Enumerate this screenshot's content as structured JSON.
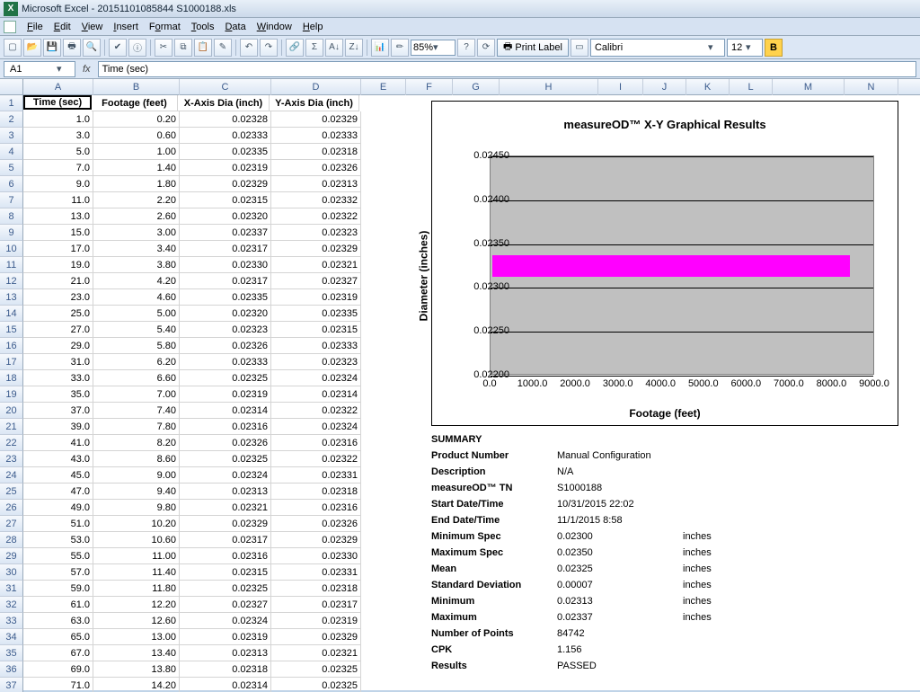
{
  "title": "Microsoft Excel - 20151101085844 S1000188.xls",
  "menus": [
    "File",
    "Edit",
    "View",
    "Insert",
    "Format",
    "Tools",
    "Data",
    "Window",
    "Help"
  ],
  "menu_underline_idx": [
    0,
    0,
    0,
    0,
    1,
    0,
    0,
    0,
    0
  ],
  "toolbar": {
    "zoom": "85%",
    "printlabel": "Print Label",
    "font": "Calibri",
    "size": "12",
    "bold": "B"
  },
  "namebox": "A1",
  "formula_fx": "fx",
  "formula": "Time (sec)",
  "col_letters": [
    "A",
    "B",
    "C",
    "D",
    "E",
    "F",
    "G",
    "H",
    "I",
    "J",
    "K",
    "L",
    "M",
    "N"
  ],
  "row_numbers": [
    "1",
    "2",
    "3",
    "4",
    "5",
    "6",
    "7",
    "8",
    "9",
    "10",
    "11",
    "12",
    "13",
    "14",
    "15",
    "16",
    "17",
    "18",
    "19",
    "20",
    "21",
    "22",
    "23",
    "24",
    "25",
    "26",
    "27",
    "28",
    "29",
    "30",
    "31",
    "32",
    "33",
    "34",
    "35",
    "36",
    "37"
  ],
  "headers": [
    "Time (sec)",
    "Footage (feet)",
    "X-Axis Dia (inch)",
    "Y-Axis Dia (inch)"
  ],
  "rows": [
    [
      "1.0",
      "0.20",
      "0.02328",
      "0.02329"
    ],
    [
      "3.0",
      "0.60",
      "0.02333",
      "0.02333"
    ],
    [
      "5.0",
      "1.00",
      "0.02335",
      "0.02318"
    ],
    [
      "7.0",
      "1.40",
      "0.02319",
      "0.02326"
    ],
    [
      "9.0",
      "1.80",
      "0.02329",
      "0.02313"
    ],
    [
      "11.0",
      "2.20",
      "0.02315",
      "0.02332"
    ],
    [
      "13.0",
      "2.60",
      "0.02320",
      "0.02322"
    ],
    [
      "15.0",
      "3.00",
      "0.02337",
      "0.02323"
    ],
    [
      "17.0",
      "3.40",
      "0.02317",
      "0.02329"
    ],
    [
      "19.0",
      "3.80",
      "0.02330",
      "0.02321"
    ],
    [
      "21.0",
      "4.20",
      "0.02317",
      "0.02327"
    ],
    [
      "23.0",
      "4.60",
      "0.02335",
      "0.02319"
    ],
    [
      "25.0",
      "5.00",
      "0.02320",
      "0.02335"
    ],
    [
      "27.0",
      "5.40",
      "0.02323",
      "0.02315"
    ],
    [
      "29.0",
      "5.80",
      "0.02326",
      "0.02333"
    ],
    [
      "31.0",
      "6.20",
      "0.02333",
      "0.02323"
    ],
    [
      "33.0",
      "6.60",
      "0.02325",
      "0.02324"
    ],
    [
      "35.0",
      "7.00",
      "0.02319",
      "0.02314"
    ],
    [
      "37.0",
      "7.40",
      "0.02314",
      "0.02322"
    ],
    [
      "39.0",
      "7.80",
      "0.02316",
      "0.02324"
    ],
    [
      "41.0",
      "8.20",
      "0.02326",
      "0.02316"
    ],
    [
      "43.0",
      "8.60",
      "0.02325",
      "0.02322"
    ],
    [
      "45.0",
      "9.00",
      "0.02324",
      "0.02331"
    ],
    [
      "47.0",
      "9.40",
      "0.02313",
      "0.02318"
    ],
    [
      "49.0",
      "9.80",
      "0.02321",
      "0.02316"
    ],
    [
      "51.0",
      "10.20",
      "0.02329",
      "0.02326"
    ],
    [
      "53.0",
      "10.60",
      "0.02317",
      "0.02329"
    ],
    [
      "55.0",
      "11.00",
      "0.02316",
      "0.02330"
    ],
    [
      "57.0",
      "11.40",
      "0.02315",
      "0.02331"
    ],
    [
      "59.0",
      "11.80",
      "0.02325",
      "0.02318"
    ],
    [
      "61.0",
      "12.20",
      "0.02327",
      "0.02317"
    ],
    [
      "63.0",
      "12.60",
      "0.02324",
      "0.02319"
    ],
    [
      "65.0",
      "13.00",
      "0.02319",
      "0.02329"
    ],
    [
      "67.0",
      "13.40",
      "0.02313",
      "0.02321"
    ],
    [
      "69.0",
      "13.80",
      "0.02318",
      "0.02325"
    ],
    [
      "71.0",
      "14.20",
      "0.02314",
      "0.02325"
    ]
  ],
  "summary_heading": "SUMMARY",
  "summary": [
    {
      "k": "Product Number",
      "v": "Manual Configuration",
      "u": ""
    },
    {
      "k": "Description",
      "v": "N/A",
      "u": ""
    },
    {
      "k": "measureOD™ TN",
      "v": "S1000188",
      "u": ""
    },
    {
      "k": "Start Date/Time",
      "v": "10/31/2015 22:02",
      "u": ""
    },
    {
      "k": "End Date/Time",
      "v": "11/1/2015 8:58",
      "u": ""
    },
    {
      "k": "Minimum Spec",
      "v": "0.02300",
      "u": "inches"
    },
    {
      "k": "Maximum Spec",
      "v": "0.02350",
      "u": "inches"
    },
    {
      "k": "Mean",
      "v": "0.02325",
      "u": "inches"
    },
    {
      "k": "Standard Deviation",
      "v": "0.00007",
      "u": "inches"
    },
    {
      "k": "Minimum",
      "v": "0.02313",
      "u": "inches"
    },
    {
      "k": "Maximum",
      "v": "0.02337",
      "u": "inches"
    },
    {
      "k": "Number of Points",
      "v": "84742",
      "u": ""
    },
    {
      "k": "CPK",
      "v": "1.156",
      "u": ""
    },
    {
      "k": "Results",
      "v": "PASSED",
      "u": ""
    }
  ],
  "chart_data": {
    "type": "line",
    "title": "measureOD™ X-Y Graphical Results",
    "xlabel": "Footage (feet)",
    "ylabel": "Diameter (inches)",
    "xlim": [
      0,
      9000
    ],
    "ylim": [
      0.022,
      0.0245
    ],
    "xticks": [
      0.0,
      1000.0,
      2000.0,
      3000.0,
      4000.0,
      5000.0,
      6000.0,
      7000.0,
      8000.0,
      9000.0
    ],
    "yticks": [
      0.022,
      0.0225,
      0.023,
      0.0235,
      0.024,
      0.0245
    ],
    "series": [
      {
        "name": "X-Axis Dia",
        "x_range": [
          0,
          8500
        ],
        "y_min": 0.02313,
        "y_max": 0.02337,
        "color": "#ff00ff"
      },
      {
        "name": "Y-Axis Dia",
        "x_range": [
          0,
          8500
        ],
        "y_min": 0.02313,
        "y_max": 0.02337,
        "color": "#ff00ff"
      }
    ],
    "note": "Dense overlapping data forms a magenta band between y≈0.02313 and y≈0.02337 across x≈0–8500"
  }
}
